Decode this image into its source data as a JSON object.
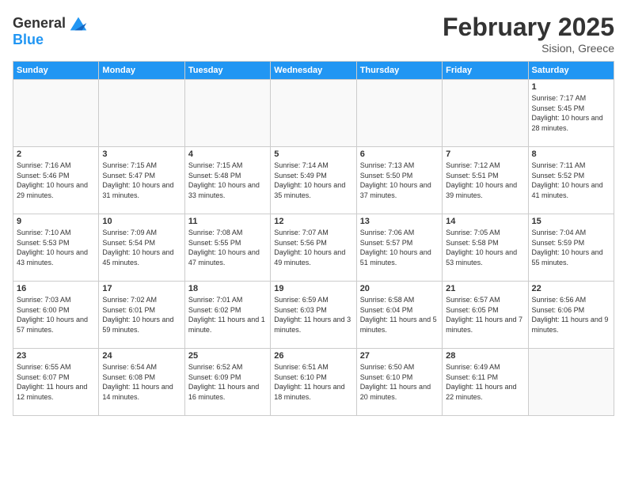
{
  "header": {
    "logo_line1": "General",
    "logo_line2": "Blue",
    "month": "February 2025",
    "location": "Sision, Greece"
  },
  "days_of_week": [
    "Sunday",
    "Monday",
    "Tuesday",
    "Wednesday",
    "Thursday",
    "Friday",
    "Saturday"
  ],
  "weeks": [
    [
      {
        "day": "",
        "detail": ""
      },
      {
        "day": "",
        "detail": ""
      },
      {
        "day": "",
        "detail": ""
      },
      {
        "day": "",
        "detail": ""
      },
      {
        "day": "",
        "detail": ""
      },
      {
        "day": "",
        "detail": ""
      },
      {
        "day": "1",
        "detail": "Sunrise: 7:17 AM\nSunset: 5:45 PM\nDaylight: 10 hours\nand 28 minutes."
      }
    ],
    [
      {
        "day": "2",
        "detail": "Sunrise: 7:16 AM\nSunset: 5:46 PM\nDaylight: 10 hours\nand 29 minutes."
      },
      {
        "day": "3",
        "detail": "Sunrise: 7:15 AM\nSunset: 5:47 PM\nDaylight: 10 hours\nand 31 minutes."
      },
      {
        "day": "4",
        "detail": "Sunrise: 7:15 AM\nSunset: 5:48 PM\nDaylight: 10 hours\nand 33 minutes."
      },
      {
        "day": "5",
        "detail": "Sunrise: 7:14 AM\nSunset: 5:49 PM\nDaylight: 10 hours\nand 35 minutes."
      },
      {
        "day": "6",
        "detail": "Sunrise: 7:13 AM\nSunset: 5:50 PM\nDaylight: 10 hours\nand 37 minutes."
      },
      {
        "day": "7",
        "detail": "Sunrise: 7:12 AM\nSunset: 5:51 PM\nDaylight: 10 hours\nand 39 minutes."
      },
      {
        "day": "8",
        "detail": "Sunrise: 7:11 AM\nSunset: 5:52 PM\nDaylight: 10 hours\nand 41 minutes."
      }
    ],
    [
      {
        "day": "9",
        "detail": "Sunrise: 7:10 AM\nSunset: 5:53 PM\nDaylight: 10 hours\nand 43 minutes."
      },
      {
        "day": "10",
        "detail": "Sunrise: 7:09 AM\nSunset: 5:54 PM\nDaylight: 10 hours\nand 45 minutes."
      },
      {
        "day": "11",
        "detail": "Sunrise: 7:08 AM\nSunset: 5:55 PM\nDaylight: 10 hours\nand 47 minutes."
      },
      {
        "day": "12",
        "detail": "Sunrise: 7:07 AM\nSunset: 5:56 PM\nDaylight: 10 hours\nand 49 minutes."
      },
      {
        "day": "13",
        "detail": "Sunrise: 7:06 AM\nSunset: 5:57 PM\nDaylight: 10 hours\nand 51 minutes."
      },
      {
        "day": "14",
        "detail": "Sunrise: 7:05 AM\nSunset: 5:58 PM\nDaylight: 10 hours\nand 53 minutes."
      },
      {
        "day": "15",
        "detail": "Sunrise: 7:04 AM\nSunset: 5:59 PM\nDaylight: 10 hours\nand 55 minutes."
      }
    ],
    [
      {
        "day": "16",
        "detail": "Sunrise: 7:03 AM\nSunset: 6:00 PM\nDaylight: 10 hours\nand 57 minutes."
      },
      {
        "day": "17",
        "detail": "Sunrise: 7:02 AM\nSunset: 6:01 PM\nDaylight: 10 hours\nand 59 minutes."
      },
      {
        "day": "18",
        "detail": "Sunrise: 7:01 AM\nSunset: 6:02 PM\nDaylight: 11 hours\nand 1 minute."
      },
      {
        "day": "19",
        "detail": "Sunrise: 6:59 AM\nSunset: 6:03 PM\nDaylight: 11 hours\nand 3 minutes."
      },
      {
        "day": "20",
        "detail": "Sunrise: 6:58 AM\nSunset: 6:04 PM\nDaylight: 11 hours\nand 5 minutes."
      },
      {
        "day": "21",
        "detail": "Sunrise: 6:57 AM\nSunset: 6:05 PM\nDaylight: 11 hours\nand 7 minutes."
      },
      {
        "day": "22",
        "detail": "Sunrise: 6:56 AM\nSunset: 6:06 PM\nDaylight: 11 hours\nand 9 minutes."
      }
    ],
    [
      {
        "day": "23",
        "detail": "Sunrise: 6:55 AM\nSunset: 6:07 PM\nDaylight: 11 hours\nand 12 minutes."
      },
      {
        "day": "24",
        "detail": "Sunrise: 6:54 AM\nSunset: 6:08 PM\nDaylight: 11 hours\nand 14 minutes."
      },
      {
        "day": "25",
        "detail": "Sunrise: 6:52 AM\nSunset: 6:09 PM\nDaylight: 11 hours\nand 16 minutes."
      },
      {
        "day": "26",
        "detail": "Sunrise: 6:51 AM\nSunset: 6:10 PM\nDaylight: 11 hours\nand 18 minutes."
      },
      {
        "day": "27",
        "detail": "Sunrise: 6:50 AM\nSunset: 6:10 PM\nDaylight: 11 hours\nand 20 minutes."
      },
      {
        "day": "28",
        "detail": "Sunrise: 6:49 AM\nSunset: 6:11 PM\nDaylight: 11 hours\nand 22 minutes."
      },
      {
        "day": "",
        "detail": ""
      }
    ]
  ]
}
